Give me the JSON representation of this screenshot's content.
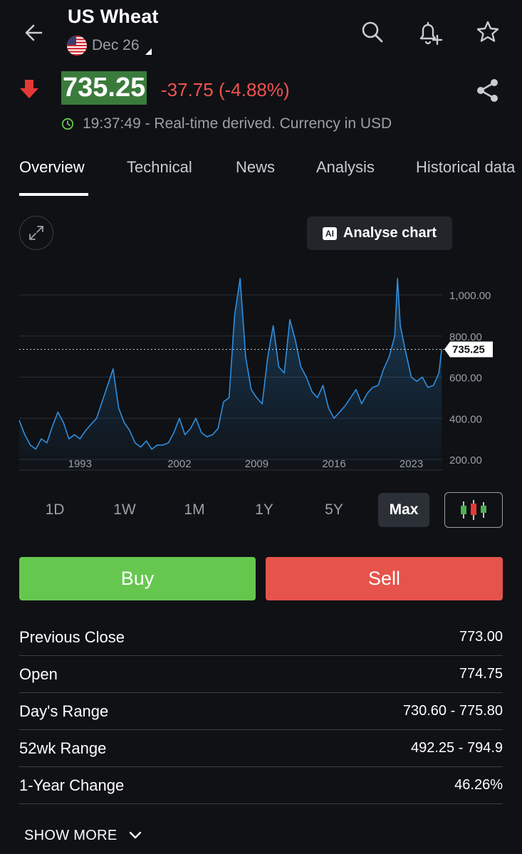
{
  "header": {
    "title": "US Wheat",
    "contract": "Dec 26",
    "icons": [
      "back-arrow-icon",
      "us-flag-icon",
      "search-icon",
      "add-alert-icon",
      "star-icon"
    ]
  },
  "quote": {
    "price": "735.25",
    "change": "-37.75 (-4.88%)",
    "direction": "down",
    "time_note": "19:37:49 - Real-time derived. Currency in USD",
    "colors": {
      "down": "#ef5350",
      "price_bg": "#3a7b3c",
      "clock": "#66c74f"
    }
  },
  "tabs": [
    {
      "label": "Overview",
      "active": true
    },
    {
      "label": "Technical"
    },
    {
      "label": "News"
    },
    {
      "label": "Analysis"
    },
    {
      "label": "Historical data"
    }
  ],
  "chart_toolbar": {
    "analyse_label": "Analyse chart",
    "ai_badge": "AI"
  },
  "chart_data": {
    "type": "area",
    "x_ticks": [
      "1993",
      "2002",
      "2009",
      "2016",
      "2023"
    ],
    "y_ticks": [
      "1,000.00",
      "800.00",
      "600.00",
      "400.00",
      "200.00"
    ],
    "ylim": [
      200,
      1000
    ],
    "current_value": 735.25,
    "current_label": "735.25",
    "line_color": "#2f8ee0",
    "series": [
      [
        1988.0,
        390
      ],
      [
        1988.5,
        320
      ],
      [
        1989.0,
        270
      ],
      [
        1989.5,
        250
      ],
      [
        1990.0,
        300
      ],
      [
        1990.5,
        280
      ],
      [
        1991.0,
        360
      ],
      [
        1991.5,
        430
      ],
      [
        1992.0,
        380
      ],
      [
        1992.5,
        300
      ],
      [
        1993.0,
        320
      ],
      [
        1993.5,
        300
      ],
      [
        1994.0,
        340
      ],
      [
        1994.5,
        370
      ],
      [
        1995.0,
        400
      ],
      [
        1995.5,
        480
      ],
      [
        1996.0,
        560
      ],
      [
        1996.5,
        640
      ],
      [
        1997.0,
        450
      ],
      [
        1997.5,
        380
      ],
      [
        1998.0,
        340
      ],
      [
        1998.5,
        280
      ],
      [
        1999.0,
        260
      ],
      [
        1999.5,
        290
      ],
      [
        2000.0,
        250
      ],
      [
        2000.5,
        270
      ],
      [
        2001.0,
        270
      ],
      [
        2001.5,
        280
      ],
      [
        2002.0,
        330
      ],
      [
        2002.5,
        400
      ],
      [
        2003.0,
        320
      ],
      [
        2003.5,
        350
      ],
      [
        2004.0,
        400
      ],
      [
        2004.5,
        330
      ],
      [
        2005.0,
        310
      ],
      [
        2005.5,
        320
      ],
      [
        2006.0,
        350
      ],
      [
        2006.5,
        480
      ],
      [
        2007.0,
        500
      ],
      [
        2007.5,
        900
      ],
      [
        2008.0,
        1080
      ],
      [
        2008.5,
        700
      ],
      [
        2009.0,
        540
      ],
      [
        2009.5,
        500
      ],
      [
        2010.0,
        470
      ],
      [
        2010.5,
        700
      ],
      [
        2011.0,
        850
      ],
      [
        2011.5,
        650
      ],
      [
        2012.0,
        620
      ],
      [
        2012.5,
        880
      ],
      [
        2013.0,
        780
      ],
      [
        2013.5,
        650
      ],
      [
        2014.0,
        600
      ],
      [
        2014.5,
        530
      ],
      [
        2015.0,
        500
      ],
      [
        2015.5,
        560
      ],
      [
        2016.0,
        450
      ],
      [
        2016.5,
        400
      ],
      [
        2017.0,
        430
      ],
      [
        2017.5,
        460
      ],
      [
        2018.0,
        500
      ],
      [
        2018.5,
        540
      ],
      [
        2019.0,
        470
      ],
      [
        2019.5,
        520
      ],
      [
        2020.0,
        550
      ],
      [
        2020.5,
        560
      ],
      [
        2021.0,
        640
      ],
      [
        2021.5,
        700
      ],
      [
        2022.0,
        800
      ],
      [
        2022.25,
        1080
      ],
      [
        2022.5,
        850
      ],
      [
        2023.0,
        720
      ],
      [
        2023.5,
        600
      ],
      [
        2024.0,
        580
      ],
      [
        2024.5,
        600
      ],
      [
        2025.0,
        550
      ],
      [
        2025.5,
        560
      ],
      [
        2026.0,
        620
      ],
      [
        2026.25,
        735.25
      ]
    ]
  },
  "ranges": [
    {
      "label": "1D"
    },
    {
      "label": "1W"
    },
    {
      "label": "1M"
    },
    {
      "label": "1Y"
    },
    {
      "label": "5Y"
    },
    {
      "label": "Max",
      "active": true
    }
  ],
  "actions": {
    "buy": "Buy",
    "sell": "Sell",
    "buy_color": "#66c74f",
    "sell_color": "#e5534b"
  },
  "stats": [
    {
      "label": "Previous Close",
      "value": "773.00"
    },
    {
      "label": "Open",
      "value": "774.75"
    },
    {
      "label": "Day's Range",
      "value": "730.60 - 775.80"
    },
    {
      "label": "52wk Range",
      "value": "492.25 - 794.9"
    },
    {
      "label": "1-Year Change",
      "value": "46.26%"
    }
  ],
  "show_more": "SHOW MORE"
}
